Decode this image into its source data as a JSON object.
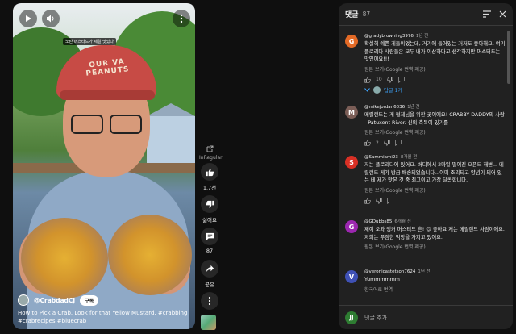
{
  "video": {
    "caption_chip": "노란 머스타드가 제일 맛있다",
    "cap_text": "OUR VA PEANUTS",
    "channel": "@CrabdadCJ",
    "subscribe_label": "구독",
    "title": "How to Pick a Crab. Look for that Yellow Mustard. #crabbing #crabrecipes #bluecrab"
  },
  "actions": {
    "top_label": "InRegular",
    "like_count": "1.7천",
    "dislike_label": "싫어요",
    "comment_count": "87",
    "share_label": "공유"
  },
  "comments_panel": {
    "title": "댓글",
    "count": "87",
    "comments": [
      {
        "author": "@gradybrowning3976",
        "time": "1년 전",
        "avatar_letter": "G",
        "avatar_color": "#e36a26",
        "text": "확실히 예쁜 게들이었는데, 거기에 들어있는 거저도 좋아해요. 여기 플로리다 사람들은 모두 내가 이상하다고 생각하지만 머스터드는 맛있어요!!!",
        "translate": "원본 보기(Google 번역 제공)",
        "likes": "10",
        "replies": "답글 1개"
      },
      {
        "author": "@mikejordan6036",
        "time": "1년 전",
        "avatar_letter": "M",
        "avatar_color": "#7b5e57",
        "text": "메릴랜드는 게 형제님을 위한 곳이에요! CRABBY DADDY의 사랑 - Patuxent River. 신의 축복이 있기를",
        "translate": "원본 보기(Google 번역 제공)",
        "likes": "2"
      },
      {
        "author": "@Sammiami23",
        "time": "8개월 전",
        "avatar_letter": "S",
        "avatar_color": "#d93025",
        "text": "저는 플로리다에 있어요. 버디에서 2마일 떨어진 오픈드 해변... 메릴랜드 게가 방금 배송되었습니다...이미 조리되고 양념이 되어 있는 데 제가 맛본 것 중 최고이고 가장 달콤합니다.",
        "translate": "원본 보기(Google 번역 제공)",
        "likes": ""
      },
      {
        "author": "@GDubbs85",
        "time": "6개월 전",
        "avatar_letter": "G",
        "avatar_color": "#9c27b0",
        "text": "제이 오와 앵커 머스터드 흔! 😊 좋아요 저는 메릴랜드 사람이에요. 저희는 푸짐한 먹방을 가지고 있어요.",
        "translate": "원본 보기(Google 번역 제공)",
        "likes": ""
      },
      {
        "author": "@veronicastetson7624",
        "time": "1년 전",
        "avatar_letter": "V",
        "avatar_color": "#3f51b5",
        "text": "Yummmmmm",
        "translate": "한국어로 번역",
        "likes": ""
      }
    ],
    "add_placeholder": "댓글 추가...",
    "my_avatar": "JJ"
  }
}
